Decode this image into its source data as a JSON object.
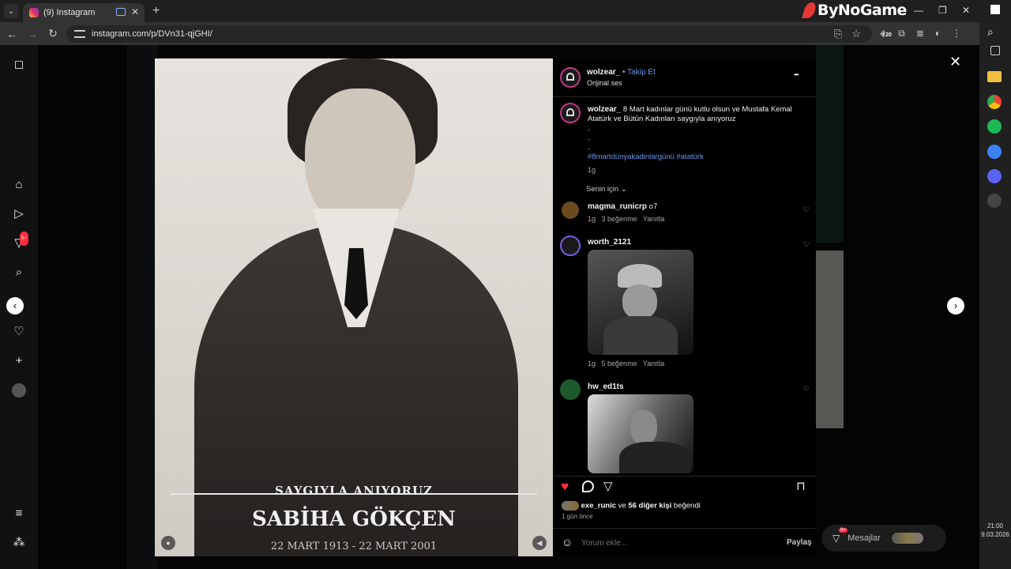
{
  "browser": {
    "tab_title": "(9) Instagram",
    "url": "instagram.com/p/DVn31-qjGHI/",
    "brand": "ByNoGame",
    "extension_badge": "20"
  },
  "taskbar": {
    "time": "21:00",
    "date": "9.03.2026"
  },
  "sidenav": {
    "notif_badge": "9+"
  },
  "photo": {
    "caption_top": "SAYGIYLA ANIYORUZ",
    "caption_name": "SABİHA GÖKÇEN",
    "caption_dates": "22 MART 1913 - 22 MART 2001"
  },
  "post": {
    "author": "wolzear_",
    "follow": "Takip Et",
    "audio": "Orijinal ses",
    "more": "•••",
    "caption_user": "wolzear_",
    "caption_text": "8 Mart kadınlar günü kutlu olsun ve Mustafa Kemal Atatürk ve Bütün Kadınları saygıyla anıyoruz",
    "caption_dots": [
      ".",
      ".",
      "."
    ],
    "hashtags": "#8martdünyakadinlargünü #atatürk",
    "caption_time": "1g",
    "sort_label": "Senin için"
  },
  "comments": [
    {
      "user": "magma_runicrp",
      "text": "o7",
      "time": "1g",
      "likes": "3 beğenme",
      "reply": "Yanıtla"
    },
    {
      "user": "worth_2121",
      "text": "",
      "time": "1g",
      "likes": "5 beğenme",
      "reply": "Yanıtla"
    },
    {
      "user": "hw_ed1ts",
      "text": ""
    }
  ],
  "likes": {
    "liked_by_user": "exe_runic",
    "liked_by_join": "ve",
    "liked_by_others": "56 diğer kişi",
    "liked_by_suffix": "beğendi",
    "time_ago": "1 gün önce"
  },
  "comment_box": {
    "placeholder": "Yorum ekle...",
    "post_label": "Paylaş"
  },
  "messages": {
    "label": "Mesajlar",
    "badge": "9+"
  },
  "colors": {
    "like_red": "#ff3040",
    "link_blue": "#6495ed",
    "panel_bg": "#000000"
  }
}
